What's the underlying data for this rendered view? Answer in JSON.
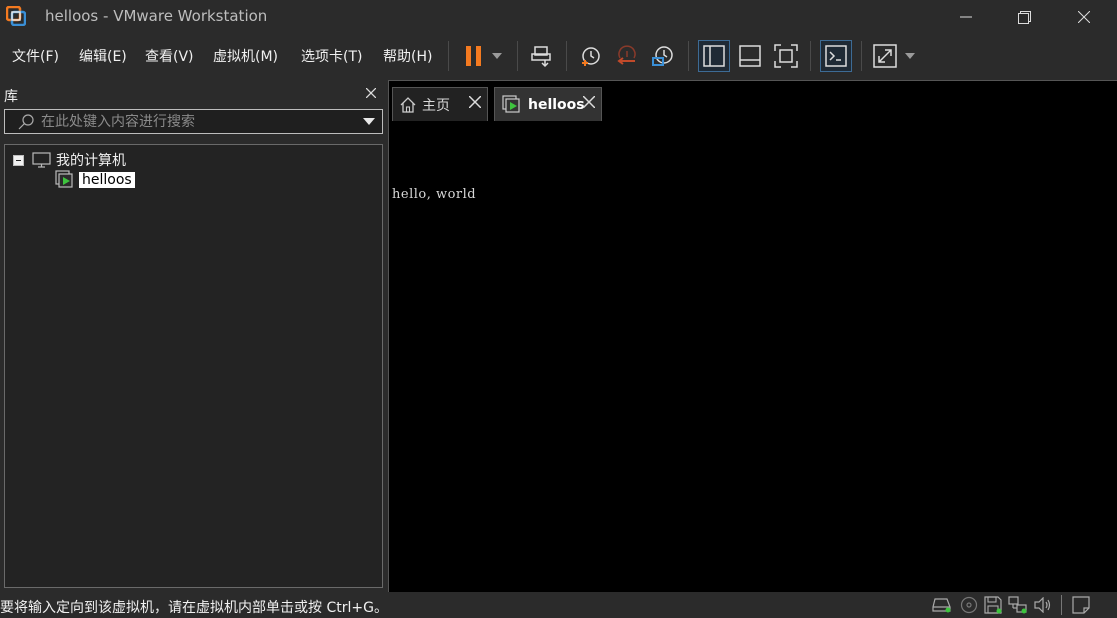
{
  "window": {
    "title": "helloos - VMware Workstation",
    "logo_icon": "vmware-logo-icon",
    "controls": [
      "minimize-icon",
      "restore-icon",
      "close-icon"
    ]
  },
  "menu": {
    "items": [
      "文件(F)",
      "编辑(E)",
      "查看(V)",
      "虚拟机(M)",
      "选项卡(T)",
      "帮助(H)"
    ]
  },
  "toolbar": {
    "accent_color": "#f47a20",
    "buttons": [
      "pause-icon",
      "power-dropdown-icon",
      "send-ctrl-alt-del-icon",
      "snapshot-take-icon",
      "snapshot-revert-icon",
      "snapshot-manager-icon",
      "show-library-icon",
      "show-thumbnail-icon",
      "full-screen-icon",
      "console-view-icon",
      "stretch-guest-icon",
      "stretch-dropdown-icon"
    ]
  },
  "library": {
    "title": "库",
    "search_placeholder": "在此处键入内容进行搜索",
    "tree": {
      "root_label": "我的计算机",
      "vm_label": "helloos"
    }
  },
  "tabs": [
    {
      "label": "主页",
      "icon": "home-icon",
      "active": false
    },
    {
      "label": "helloos",
      "icon": "vm-running-icon",
      "active": true
    }
  ],
  "console": {
    "output": "hello, world",
    "background": "#000000"
  },
  "status": {
    "message": "要将输入定向到该虚拟机，请在虚拟机内部单击或按 Ctrl+G。",
    "device_icons": [
      "hard-disk-icon",
      "cd-dvd-icon",
      "floppy-icon",
      "network-adapter-icon",
      "sound-card-icon",
      "message-log-icon"
    ],
    "active_color": "#3ec43e"
  }
}
